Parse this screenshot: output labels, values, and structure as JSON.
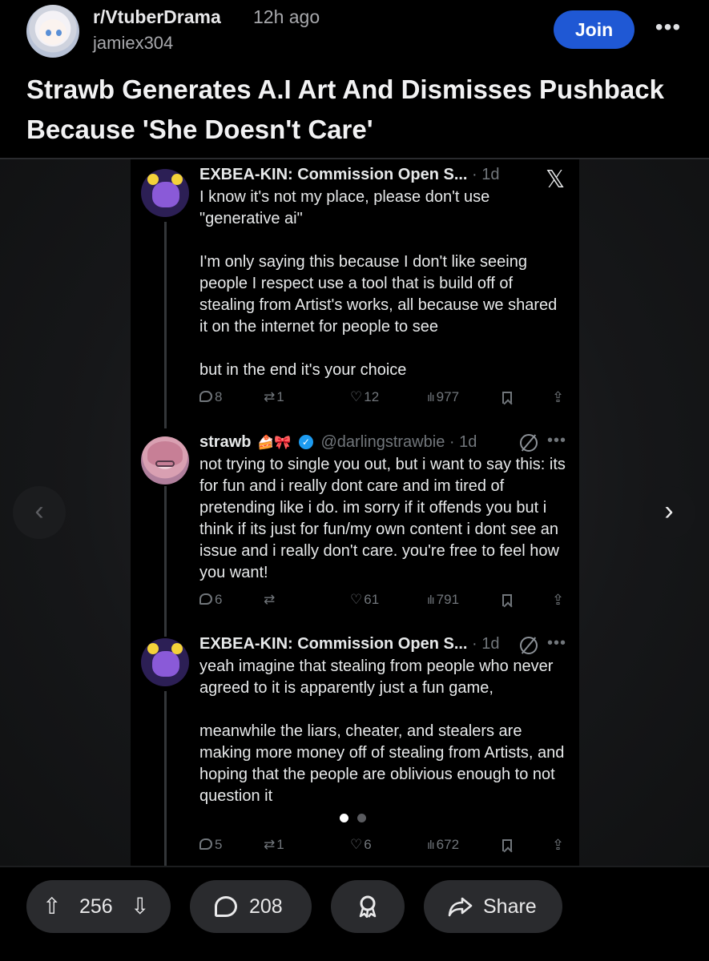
{
  "header": {
    "subreddit": "r/VtuberDrama",
    "time": "12h ago",
    "author": "jamiex304",
    "join_label": "Join",
    "more_label": "•••"
  },
  "post": {
    "title": "Strawb Generates A.I Art And Dismisses Pushback Because 'She Doesn't Care'"
  },
  "gallery": {
    "prev_label": "‹",
    "next_label": "›",
    "page_count": 2,
    "active_page": 1
  },
  "screenshot": {
    "x_logo": "𝕏",
    "tweets": [
      {
        "name": "EXBEA-KIN: Commission Open S...",
        "handle": "",
        "time": "· 1d",
        "text": "I know it's not my place, please don't use \"generative ai\"\n\nI'm only saying this because I don't like seeing people I respect use a tool that is build off of stealing from Artist's works, all because we shared it on the internet for people to see\n\nbut in the end it's your choice",
        "replies": "8",
        "retweets": "1",
        "likes": "12",
        "views": "977"
      },
      {
        "name": "strawb",
        "emoji": "🍰🎀",
        "verified": "✓",
        "handle": "@darlingstrawbie",
        "time": "· 1d",
        "text": "not trying to single you out, but i want to say this: its for fun and i really dont care and im tired of pretending like i do. im sorry if it offends you but i think if its just for fun/my own content i dont see an issue and i really don't care. you're free to feel how you want!",
        "replies": "6",
        "retweets": "",
        "likes": "61",
        "views": "791"
      },
      {
        "name": "EXBEA-KIN: Commission Open S...",
        "handle": "",
        "time": "· 1d",
        "text": "yeah imagine that stealing from people who never agreed to it is apparently just a fun game,\n\nmeanwhile the liars, cheater, and stealers are making more money off of stealing from Artists, and hoping that the people are oblivious enough to not question it",
        "replies": "5",
        "retweets": "1",
        "likes": "6",
        "views": "672"
      }
    ]
  },
  "footer": {
    "upvote_count": "256",
    "comment_count": "208",
    "share_label": "Share"
  },
  "colors": {
    "join_blue": "#1f58d4",
    "pill_bg": "#2a2b2e",
    "verified_blue": "#1d9bf0"
  },
  "icons": [
    "upvote-icon",
    "downvote-icon",
    "comment-icon",
    "award-icon",
    "share-icon",
    "x-logo-icon"
  ]
}
